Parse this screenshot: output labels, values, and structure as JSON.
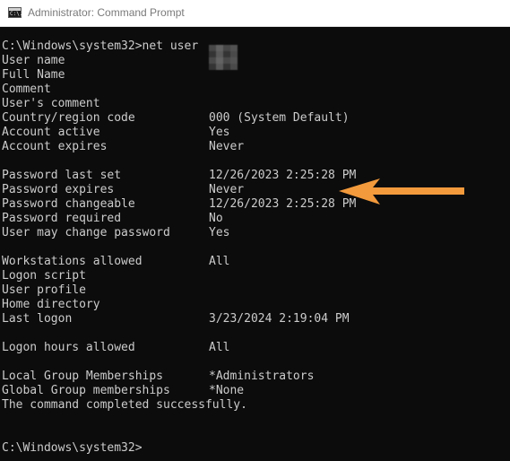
{
  "window": {
    "title": "Administrator: Command Prompt",
    "icon": "cmd-icon",
    "icon_text": "C:\\."
  },
  "console": {
    "command_line": "C:\\Windows\\system32>net user ",
    "rows": [
      {
        "label": "User name",
        "value": ""
      },
      {
        "label": "Full Name",
        "value": ""
      },
      {
        "label": "Comment",
        "value": ""
      },
      {
        "label": "User's comment",
        "value": ""
      },
      {
        "label": "Country/region code",
        "value": "000 (System Default)"
      },
      {
        "label": "Account active",
        "value": "Yes"
      },
      {
        "label": "Account expires",
        "value": "Never"
      },
      {
        "label": "Password last set",
        "value": "12/26/2023 2:25:28 PM"
      },
      {
        "label": "Password expires",
        "value": "Never"
      },
      {
        "label": "Password changeable",
        "value": "12/26/2023 2:25:28 PM"
      },
      {
        "label": "Password required",
        "value": "No"
      },
      {
        "label": "User may change password",
        "value": "Yes"
      },
      {
        "label": "Workstations allowed",
        "value": "All"
      },
      {
        "label": "Logon script",
        "value": ""
      },
      {
        "label": "User profile",
        "value": ""
      },
      {
        "label": "Home directory",
        "value": ""
      },
      {
        "label": "Last logon",
        "value": "3/23/2024 2:19:04 PM"
      },
      {
        "label": "Logon hours allowed",
        "value": "All"
      },
      {
        "label": "Local Group Memberships",
        "value": "*Administrators"
      },
      {
        "label": "Global Group memberships",
        "value": "*None"
      }
    ],
    "completion": "The command completed successfully.",
    "prompt": "C:\\Windows\\system32>"
  },
  "annotation": {
    "arrow_color": "#f39a3c",
    "arrow_icon": "arrow-left-icon"
  },
  "colors": {
    "console_bg": "#0c0c0c",
    "console_text": "#cccccc",
    "titlebar_bg": "#ffffff",
    "title_text": "#7a7a7a"
  }
}
